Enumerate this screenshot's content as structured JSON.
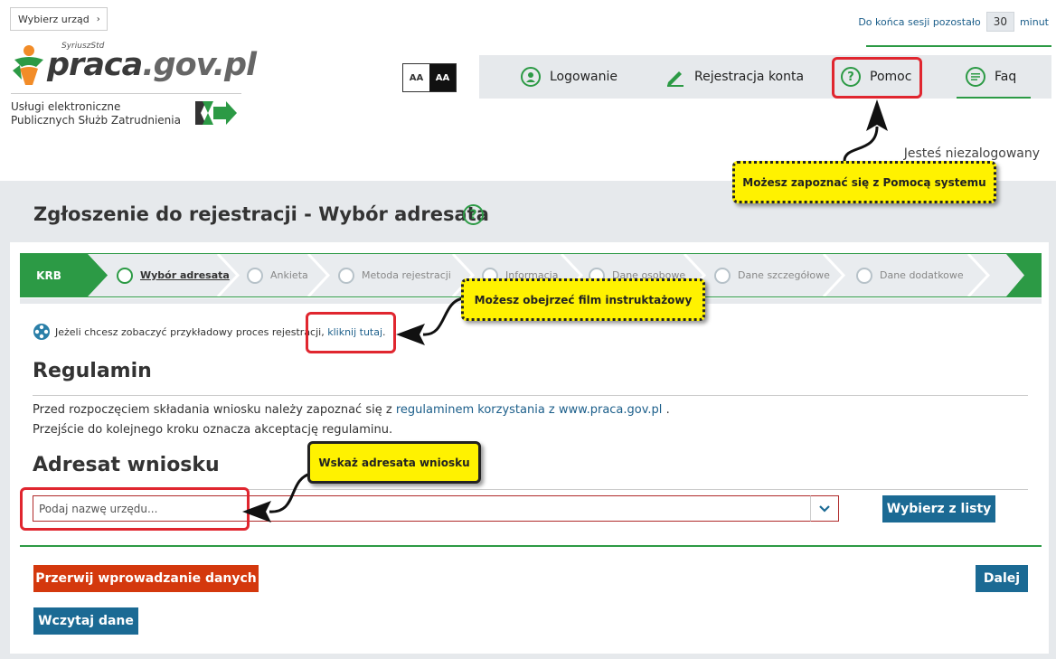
{
  "header": {
    "office_button": "Wybierz urząd",
    "session_prefix": "Do końca sesji pozostało",
    "session_minutes": "30",
    "session_suffix": "minut",
    "logo_name": "praca",
    "logo_domain": ".gov.pl",
    "logo_sup": "SyriuszStd",
    "logo_sub_line1": "Usługi elektroniczne",
    "logo_sub_line2": "Publicznych Służb Zatrudnienia",
    "aa_small": "AA",
    "aa_large": "AA",
    "not_logged": "Jesteś niezalogowany"
  },
  "nav": [
    {
      "label": "Logowanie",
      "icon": "user-icon"
    },
    {
      "label": "Rejestracja konta",
      "icon": "pencil-icon"
    },
    {
      "label": "Pomoc",
      "icon": "help-icon"
    },
    {
      "label": "Faq",
      "icon": "chat-icon"
    }
  ],
  "page": {
    "title": "Zgłoszenie do rejestracji - Wybór adresata"
  },
  "stepper": {
    "start": "KRB",
    "steps": [
      "Wybór adresata",
      "Ankieta",
      "Metoda rejestracji",
      "Informacja",
      "Dane osobowe",
      "Dane szczegółowe",
      "Dane dodatkowe"
    ]
  },
  "content": {
    "film_text": "Jeżeli chcesz zobaczyć przykładowy proces rejestracji,",
    "film_link": "kliknij tutaj",
    "film_dot": ".",
    "reg_heading": "Regulamin",
    "reg_p1_pre": "Przed rozpoczęciem składania wniosku należy zapoznać się z",
    "reg_p1_link": "regulaminem korzystania z www.praca.gov.pl",
    "reg_p1_post": ".",
    "reg_p2": "Przejście do kolejnego kroku oznacza akceptację regulaminu.",
    "adr_heading": "Adresat wniosku",
    "office_placeholder": "Podaj nazwę urzędu...",
    "pick_button": "Wybierz z listy",
    "abort_button": "Przerwij wprowadzanie danych",
    "next_button": "Dalej",
    "load_button": "Wczytaj dane"
  },
  "callouts": {
    "help": "Możesz zapoznać się z Pomocą systemu",
    "film": "Możesz obejrzeć film instruktażowy",
    "office": "Wskaż adresata wniosku"
  },
  "colors": {
    "green": "#2c9a45",
    "blue": "#1b6a94",
    "red_button": "#d4380d",
    "callout": "#fff200",
    "highlight": "#e0262f"
  }
}
